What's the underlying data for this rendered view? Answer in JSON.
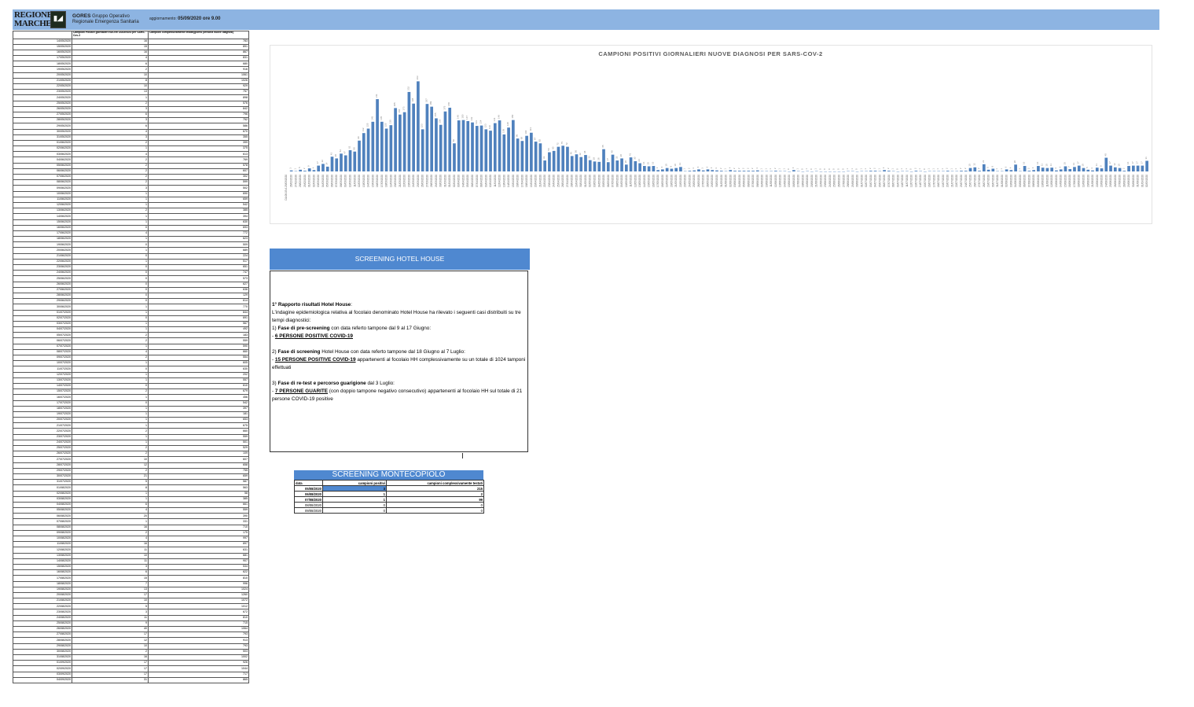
{
  "header": {
    "logo_text": [
      "REGIONE",
      "MARCHE"
    ],
    "org_title": "GORES",
    "org_subtitle": "Gruppo Operativo Regionale Emergenza Sanitaria",
    "update_label": "aggiornamento:",
    "update_value": "05/09/2020 ore 9.00"
  },
  "table": {
    "headers": [
      "",
      "Campioni Positivi giornalieri NUOVE DIAGNOSI per SARS-Cov-2",
      "Campioni complessivamente testati(giorno persona nuove diagnosi)"
    ],
    "rows": [
      [
        "14/05/2020",
        "16",
        "783"
      ],
      [
        "15/05/2020",
        "15",
        "891"
      ],
      [
        "16/05/2020",
        "16",
        "867"
      ],
      [
        "17/05/2020",
        "4",
        "831"
      ],
      [
        "18/05/2020",
        "6",
        "680"
      ],
      [
        "19/05/2020",
        "2",
        "916"
      ],
      [
        "20/05/2020",
        "10",
        "1061"
      ],
      [
        "21/05/2020",
        "8",
        "1026"
      ],
      [
        "22/05/2020",
        "10",
        "929"
      ],
      [
        "23/05/2020",
        "13",
        "757"
      ],
      [
        "24/05/2020",
        "1",
        "898"
      ],
      [
        "25/05/2020",
        "2",
        "576"
      ],
      [
        "26/05/2020",
        "3",
        "842"
      ],
      [
        "27/05/2020",
        "6",
        "796"
      ],
      [
        "28/05/2020",
        "3",
        "752"
      ],
      [
        "29/05/2020",
        "6",
        "586"
      ],
      [
        "30/05/2020",
        "4",
        "670"
      ],
      [
        "31/05/2020",
        "3",
        "355"
      ],
      [
        "01/06/2020",
        "2",
        "399"
      ],
      [
        "02/06/2020",
        "1",
        "375"
      ],
      [
        "03/06/2020",
        "4",
        "613"
      ],
      [
        "04/06/2020",
        "2",
        "769"
      ],
      [
        "05/06/2020",
        "2",
        "578"
      ],
      [
        "06/06/2020",
        "2",
        "607"
      ],
      [
        "07/06/2020",
        "2",
        "302"
      ],
      [
        "08/06/2020",
        "2",
        "599"
      ],
      [
        "09/06/2020",
        "3",
        "502"
      ],
      [
        "10/06/2020",
        "1",
        "690"
      ],
      [
        "11/06/2020",
        "1",
        "659"
      ],
      [
        "12/06/2020",
        "1",
        "542"
      ],
      [
        "13/06/2020",
        "2",
        "385"
      ],
      [
        "14/06/2020",
        "1",
        "394"
      ],
      [
        "15/06/2020",
        "1",
        "630"
      ],
      [
        "16/06/2020",
        "0",
        "693"
      ],
      [
        "17/06/2020",
        "4",
        "772"
      ],
      [
        "18/06/2020",
        "1",
        "623"
      ],
      [
        "19/06/2020",
        "0",
        "509"
      ],
      [
        "20/06/2020",
        "1",
        "689"
      ],
      [
        "21/06/2020",
        "0",
        "224"
      ],
      [
        "22/06/2020",
        "1",
        "517"
      ],
      [
        "23/06/2020",
        "0",
        "651"
      ],
      [
        "24/06/2020",
        "0",
        "747"
      ],
      [
        "25/06/2020",
        "0",
        "573"
      ],
      [
        "26/06/2020",
        "0",
        "627"
      ],
      [
        "27/06/2020",
        "0",
        "636"
      ],
      [
        "28/06/2020",
        "0",
        "129"
      ],
      [
        "29/06/2020",
        "0",
        "614"
      ],
      [
        "30/06/2020",
        "1",
        "770"
      ],
      [
        "01/07/2020",
        "1",
        "844"
      ],
      [
        "02/07/2020",
        "0",
        "691"
      ],
      [
        "03/07/2020",
        "1",
        "567"
      ],
      [
        "04/07/2020",
        "1",
        "492"
      ],
      [
        "05/07/2020",
        "2",
        "183"
      ],
      [
        "06/07/2020",
        "2",
        "559"
      ],
      [
        "07/07/2020",
        "1",
        "590"
      ],
      [
        "08/07/2020",
        "4",
        "660"
      ],
      [
        "09/07/2020",
        "2",
        "554"
      ],
      [
        "10/07/2020",
        "1",
        "605"
      ],
      [
        "11/07/2020",
        "0",
        "630"
      ],
      [
        "12/07/2020",
        "1",
        "202"
      ],
      [
        "13/07/2020",
        "1",
        "557"
      ],
      [
        "14/07/2020",
        "0",
        "610"
      ],
      [
        "15/07/2020",
        "2",
        "679"
      ],
      [
        "16/07/2020",
        "1",
        "456"
      ],
      [
        "17/07/2020",
        "0",
        "542"
      ],
      [
        "18/07/2020",
        "1",
        "397"
      ],
      [
        "19/07/2020",
        "1",
        "181"
      ],
      [
        "20/07/2020",
        "1",
        "653"
      ],
      [
        "21/07/2020",
        "1",
        "675"
      ],
      [
        "22/07/2020",
        "2",
        "660"
      ],
      [
        "23/07/2020",
        "1",
        "559"
      ],
      [
        "24/07/2020",
        "1",
        "501"
      ],
      [
        "25/07/2020",
        "2",
        "529"
      ],
      [
        "26/07/2020",
        "2",
        "109"
      ],
      [
        "27/07/2020",
        "10",
        "607"
      ],
      [
        "28/07/2020",
        "12",
        "658"
      ],
      [
        "29/07/2020",
        "2",
        "755"
      ],
      [
        "30/07/2020",
        "21",
        "659"
      ],
      [
        "31/07/2020",
        "5",
        "587"
      ],
      [
        "01/08/2020",
        "8",
        "563"
      ],
      [
        "02/08/2020",
        "1",
        "58"
      ],
      [
        "03/08/2020",
        "1",
        "385"
      ],
      [
        "04/08/2020",
        "6",
        "661"
      ],
      [
        "05/08/2020",
        "4",
        "559"
      ],
      [
        "06/08/2020",
        "20",
        "390"
      ],
      [
        "07/08/2020",
        "1",
        "331"
      ],
      [
        "08/08/2020",
        "16",
        "710"
      ],
      [
        "09/08/2020",
        "2",
        "175"
      ],
      [
        "10/08/2020",
        "4",
        "997"
      ],
      [
        "11/08/2020",
        "16",
        "897"
      ],
      [
        "12/08/2020",
        "11",
        "631"
      ],
      [
        "13/08/2020",
        "10",
        "681"
      ],
      [
        "14/08/2020",
        "11",
        "907"
      ],
      [
        "15/08/2020",
        "3",
        "534"
      ],
      [
        "16/08/2020",
        "6",
        "622"
      ],
      [
        "17/08/2020",
        "15",
        "810"
      ],
      [
        "18/08/2020",
        "7",
        "996"
      ],
      [
        "19/08/2020",
        "13",
        "1024"
      ],
      [
        "20/08/2020",
        "17",
        "1260"
      ],
      [
        "21/08/2020",
        "10",
        "1072"
      ],
      [
        "22/08/2020",
        "5",
        "1012"
      ],
      [
        "23/08/2020",
        "3",
        "672"
      ],
      [
        "24/08/2020",
        "11",
        "810"
      ],
      [
        "25/08/2020",
        "9",
        "715"
      ],
      [
        "26/08/2020",
        "40",
        "1064"
      ],
      [
        "27/08/2020",
        "17",
        "793"
      ],
      [
        "28/08/2020",
        "12",
        "913"
      ],
      [
        "29/08/2020",
        "10",
        "793"
      ],
      [
        "30/08/2020",
        "2",
        "503"
      ],
      [
        "31/08/2020",
        "16",
        "1002"
      ],
      [
        "01/09/2020",
        "17",
        "926"
      ],
      [
        "02/09/2020",
        "17",
        "1044"
      ],
      [
        "03/09/2020",
        "17",
        "717"
      ],
      [
        "04/09/2020",
        "31",
        "865"
      ]
    ]
  },
  "chart_data": {
    "type": "bar",
    "title": "CAMPIONI POSITIVI GIORNALIERI NUOVE DIAGNOSI PER SARS-COV-2",
    "xlabel": "",
    "ylabel": "",
    "first_category": "DA 08.03 A 25/03/2020",
    "categories": [
      "26/02/2020",
      "27/02/2020",
      "28/02/2020",
      "29/02/2020",
      "01/03/2020",
      "02/03/2020",
      "03/03/2020",
      "04/03/2020",
      "05/03/2020",
      "06/03/2020",
      "07/03/2020",
      "08/03/2020",
      "09/03/2020",
      "10/03/2020",
      "11/03/2020",
      "12/03/2020",
      "13/03/2020",
      "14/03/2020",
      "15/03/2020",
      "16/03/2020",
      "17/03/2020",
      "18/03/2020",
      "19/03/2020",
      "20/03/2020",
      "21/03/2020",
      "22/03/2020",
      "23/03/2020",
      "24/03/2020",
      "25/03/2020",
      "26/03/2020",
      "27/03/2020",
      "28/03/2020",
      "29/03/2020",
      "30/03/2020",
      "31/03/2020",
      "01/04/2020",
      "02/04/2020",
      "03/04/2020",
      "04/04/2020",
      "05/04/2020",
      "06/04/2020",
      "07/04/2020",
      "08/04/2020",
      "09/04/2020",
      "10/04/2020",
      "11/04/2020",
      "12/04/2020",
      "13/04/2020",
      "14/04/2020",
      "15/04/2020",
      "16/04/2020",
      "17/04/2020",
      "18/04/2020",
      "19/04/2020",
      "20/04/2020",
      "21/04/2020",
      "22/04/2020",
      "23/04/2020",
      "24/04/2020",
      "25/04/2020",
      "26/04/2020",
      "27/04/2020",
      "28/04/2020",
      "29/04/2020",
      "30/04/2020",
      "01/05/2020",
      "02/05/2020",
      "03/05/2020",
      "04/05/2020",
      "05/05/2020",
      "06/05/2020",
      "07/05/2020",
      "08/05/2020",
      "09/05/2020",
      "10/05/2020",
      "11/05/2020",
      "12/05/2020",
      "13/05/2020",
      "14/05/2020",
      "15/05/2020",
      "16/05/2020",
      "17/05/2020",
      "18/05/2020",
      "19/05/2020",
      "20/05/2020",
      "21/05/2020",
      "22/05/2020",
      "23/05/2020",
      "24/05/2020",
      "25/05/2020",
      "26/05/2020",
      "27/05/2020",
      "28/05/2020",
      "29/05/2020",
      "30/05/2020",
      "31/05/2020",
      "01/06/2020",
      "02/06/2020",
      "03/06/2020",
      "04/06/2020",
      "05/06/2020",
      "06/06/2020",
      "07/06/2020",
      "08/06/2020",
      "09/06/2020",
      "10/06/2020",
      "11/06/2020",
      "12/06/2020",
      "13/06/2020",
      "14/06/2020",
      "15/06/2020",
      "16/06/2020",
      "17/06/2020",
      "18/06/2020",
      "19/06/2020",
      "20/06/2020",
      "21/06/2020",
      "22/06/2020",
      "23/06/2020",
      "24/06/2020",
      "25/06/2020",
      "26/06/2020",
      "27/06/2020",
      "28/06/2020",
      "29/06/2020",
      "30/06/2020",
      "01/07/2020",
      "02/07/2020",
      "03/07/2020",
      "04/07/2020",
      "05/07/2020",
      "06/07/2020",
      "07/07/2020",
      "08/07/2020",
      "09/07/2020",
      "10/07/2020",
      "11/07/2020",
      "12/07/2020",
      "13/07/2020",
      "14/07/2020",
      "15/07/2020",
      "16/07/2020",
      "17/07/2020",
      "18/07/2020",
      "19/07/2020",
      "20/07/2020",
      "21/07/2020",
      "22/07/2020",
      "23/07/2020",
      "24/07/2020",
      "25/07/2020",
      "26/07/2020",
      "27/07/2020",
      "28/07/2020",
      "29/07/2020",
      "30/07/2020",
      "31/07/2020",
      "01/08/2020",
      "02/08/2020",
      "03/08/2020",
      "04/08/2020",
      "05/08/2020",
      "06/08/2020",
      "07/08/2020",
      "08/08/2020",
      "09/08/2020",
      "10/08/2020",
      "11/08/2020",
      "12/08/2020",
      "13/08/2020",
      "14/08/2020",
      "15/08/2020",
      "16/08/2020",
      "17/08/2020",
      "18/08/2020",
      "19/08/2020",
      "20/08/2020",
      "21/08/2020",
      "22/08/2020",
      "23/08/2020",
      "24/08/2020",
      "25/08/2020",
      "26/08/2020",
      "27/08/2020",
      "28/08/2020",
      "29/08/2020",
      "30/08/2020",
      "31/08/2020",
      "01/09/2020",
      "02/09/2020",
      "03/09/2020",
      "04/09/2020"
    ],
    "values": [
      3,
      1,
      5,
      2,
      9,
      4,
      17,
      22,
      14,
      43,
      38,
      52,
      47,
      62,
      58,
      90,
      112,
      125,
      145,
      211,
      145,
      125,
      135,
      185,
      166,
      173,
      232,
      198,
      263,
      123,
      197,
      189,
      155,
      136,
      175,
      186,
      82,
      149,
      150,
      147,
      143,
      133,
      134,
      123,
      119,
      141,
      149,
      108,
      128,
      150,
      96,
      89,
      104,
      113,
      87,
      82,
      32,
      56,
      60,
      72,
      75,
      72,
      45,
      50,
      42,
      48,
      33,
      29,
      28,
      65,
      27,
      49,
      32,
      38,
      20,
      41,
      30,
      24,
      16,
      15,
      16,
      4,
      6,
      10,
      8,
      10,
      13,
      1,
      2,
      3,
      6,
      3,
      6,
      4,
      3,
      2,
      1,
      4,
      2,
      2,
      2,
      2,
      2,
      3,
      1,
      1,
      1,
      2,
      1,
      1,
      0,
      4,
      1,
      0,
      1,
      0,
      1,
      0,
      0,
      0,
      0,
      0,
      0,
      1,
      1,
      0,
      1,
      1,
      2,
      2,
      1,
      4,
      2,
      1,
      0,
      1,
      1,
      0,
      2,
      1,
      0,
      1,
      1,
      1,
      1,
      2,
      1,
      1,
      2,
      2,
      10,
      12,
      2,
      21,
      5,
      8,
      1,
      1,
      6,
      4,
      20,
      1,
      16,
      2,
      4,
      16,
      11,
      10,
      11,
      3,
      6,
      15,
      7,
      13,
      17,
      10,
      5,
      3,
      11,
      9,
      40,
      17,
      12,
      10,
      2,
      16,
      17,
      17,
      17,
      31
    ],
    "ylim": [
      0,
      280
    ],
    "color": "#4f81bd"
  },
  "hotel_house": {
    "title": "SCREENING HOTEL HOUSE",
    "p1_bold": "1° Rapporto  risultati Hotel House",
    "p1_rest": ":",
    "p2": "L'indagine epidemiologica relativa al focolaio denominato Hotel House ha rilevato i seguenti casi distribuiti su tre tempi diagnostici:",
    "s1_num": "1) ",
    "s1_bold": "Fase di pre-screening",
    "s1_rest": " con data referto tampone dal 9 al 17 Giugno:",
    "s1_dash": "- ",
    "s1_res": "6 PERSONE POSITIVE COVID-19",
    "s2_num": "2) ",
    "s2_bold": "Fase di screening",
    "s2_rest": " Hotel House con data referto tampone dal 18 Giugno al 7 Luglio:",
    "s2_dash": "- ",
    "s2_res": "15 PERSONE POSITIVE COVID-19",
    "s2_rest2": " appartenenti al focolaio HH complessivamente su un totale di 1024 tamponi effettuati",
    "s3_num": "3) ",
    "s3_bold": "Fase di re-test e percorso guarigione",
    "s3_rest": " dal 3 Luglio:",
    "s3_dash": "- ",
    "s3_res": "7 PERSONE GUARITE",
    "s3_rest2": " (con doppio tampone negativo consecutivo) appartenenti al focolaio HH sul totale di 21 persone COVID-19 positive"
  },
  "montecopiolo": {
    "title": "SCREENING MONTECOPIOLO",
    "headers": [
      "data",
      "campioni positivi",
      "campioni complessivamente testati"
    ],
    "rows": [
      [
        "05/08/2020",
        "3",
        "215"
      ],
      [
        "06/08/2020",
        "1",
        "2"
      ],
      [
        "07/08/2020",
        "1",
        "99"
      ],
      [
        "08/08/2020",
        "0",
        "0"
      ],
      [
        "09/08/2020",
        "0",
        "0"
      ]
    ]
  }
}
